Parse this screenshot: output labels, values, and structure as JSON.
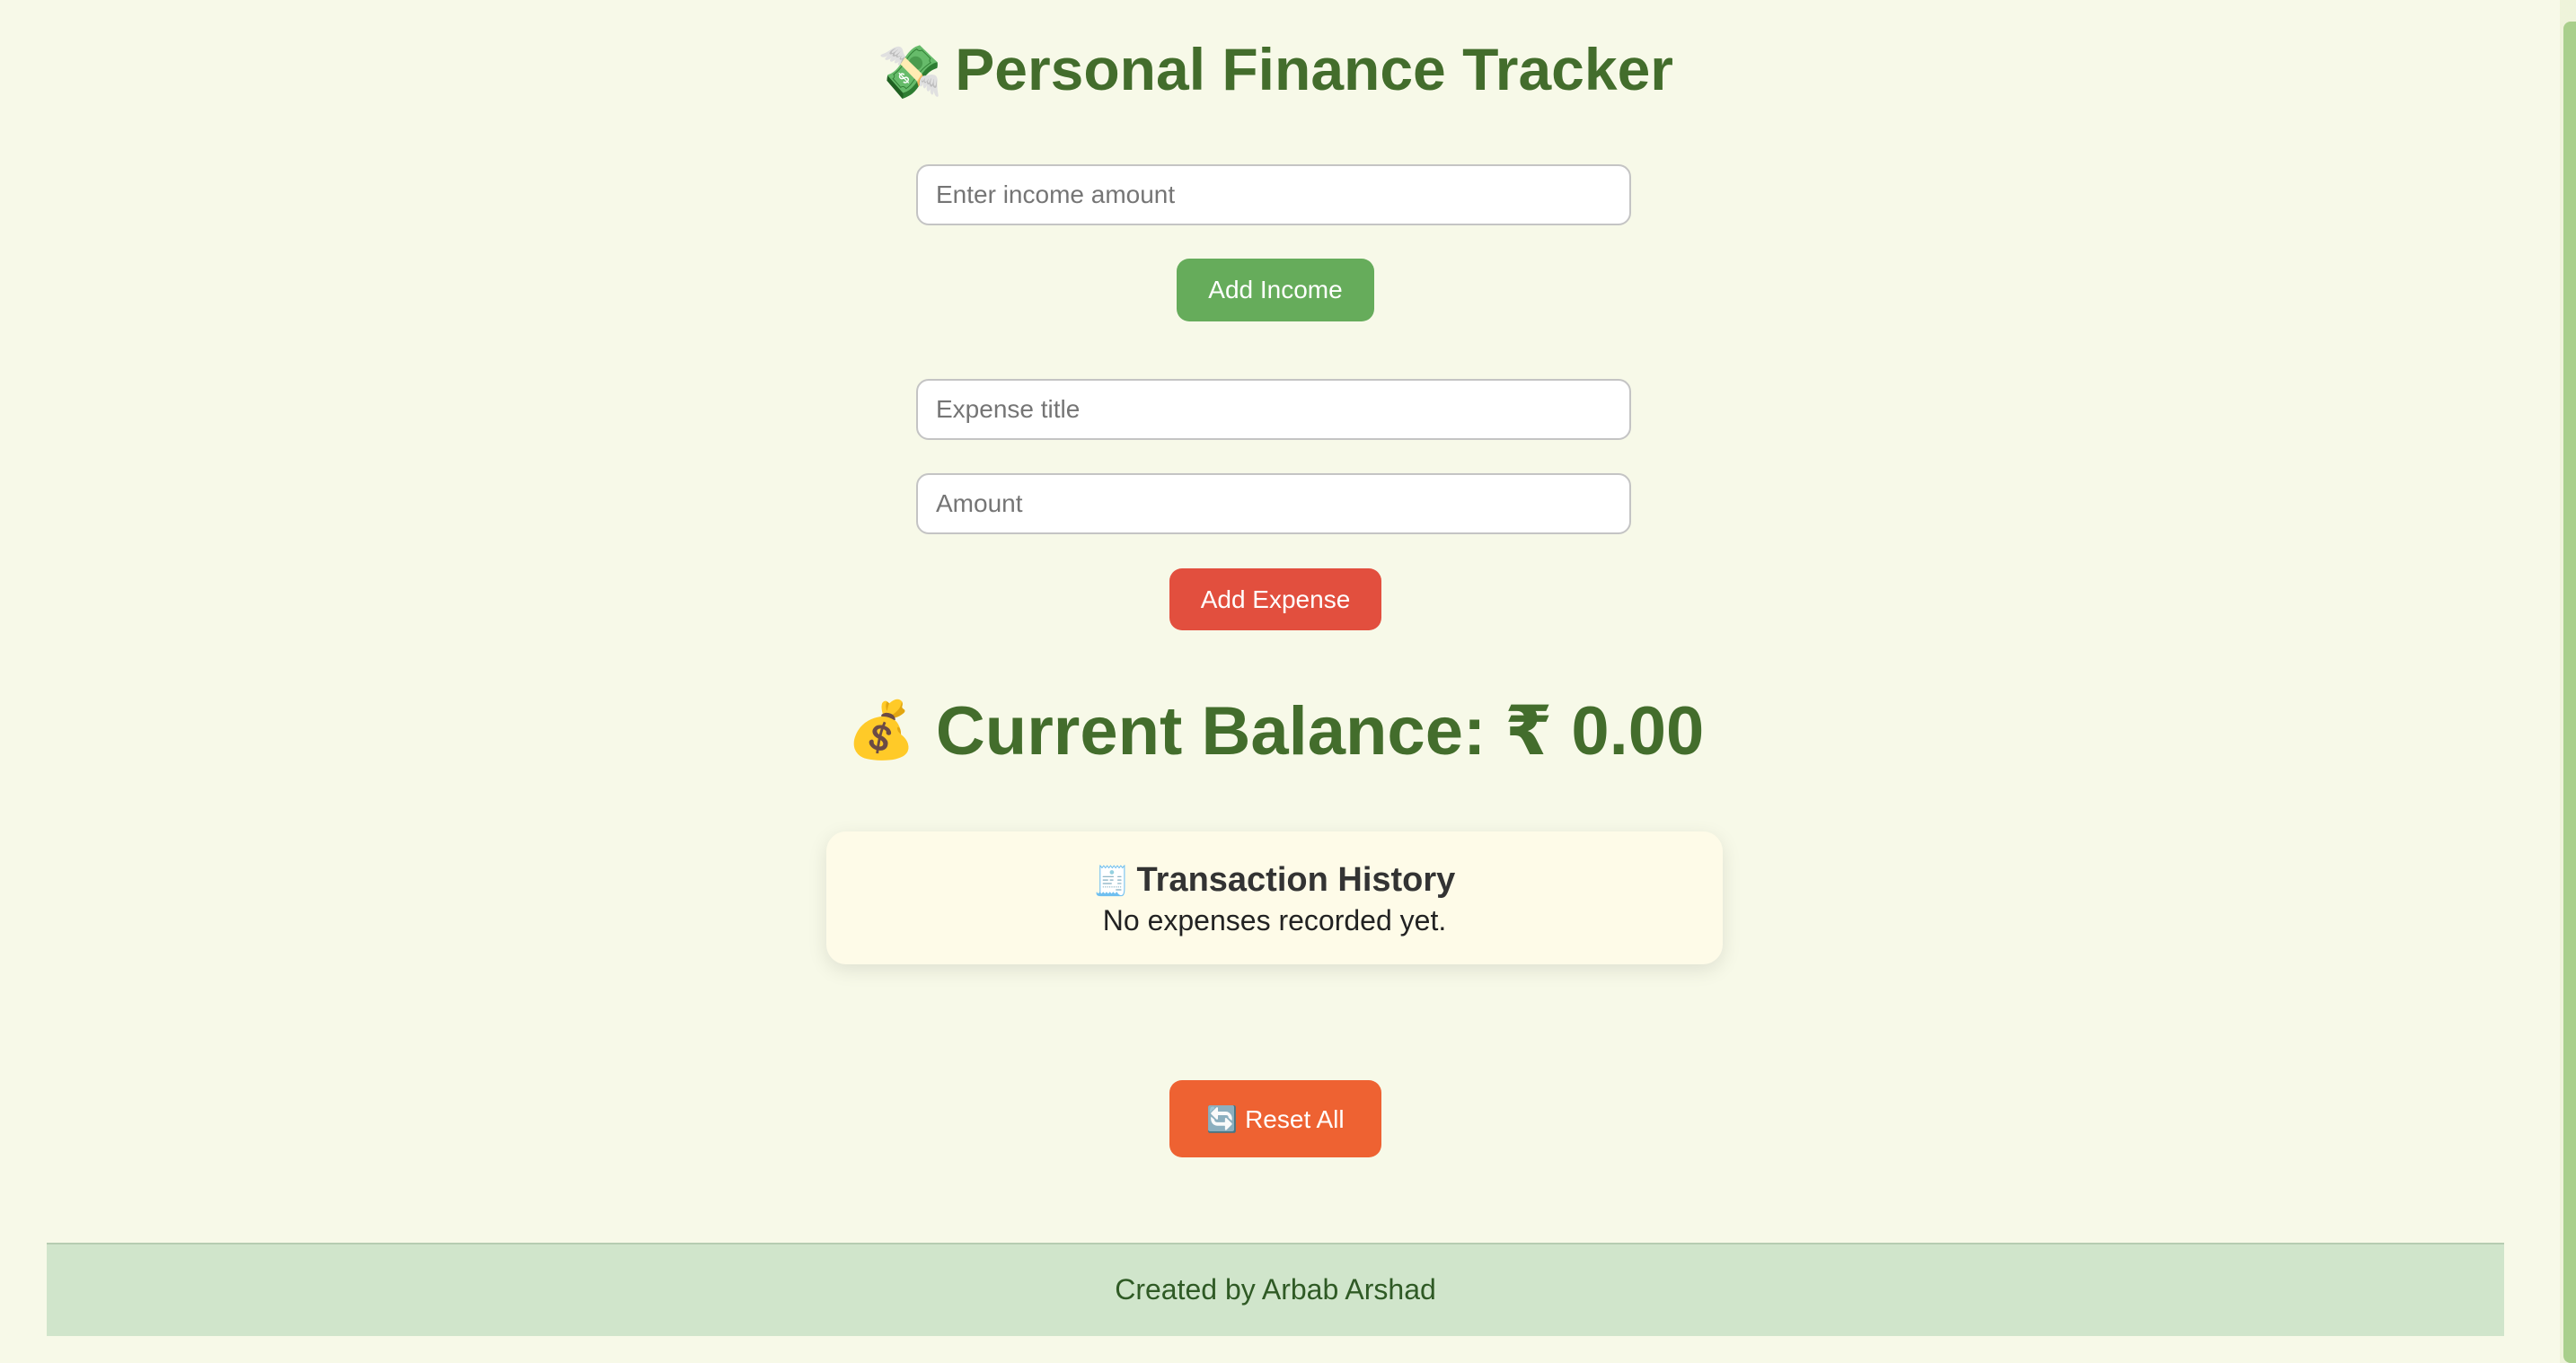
{
  "header": {
    "title_icon": "💸",
    "title": "Personal Finance Tracker"
  },
  "income": {
    "placeholder": "Enter income amount",
    "button_label": "Add Income"
  },
  "expense": {
    "title_placeholder": "Expense title",
    "amount_placeholder": "Amount",
    "button_label": "Add Expense"
  },
  "balance": {
    "icon": "💰",
    "text": "Current Balance: ₹ 0.00"
  },
  "history": {
    "icon": "🧾",
    "title": "Transaction History",
    "empty_message": "No expenses recorded yet."
  },
  "reset": {
    "icon": "🔄",
    "label": "Reset All"
  },
  "footer": {
    "text": "Created by Arbab Arshad"
  },
  "colors": {
    "background": "#f7f9e8",
    "accent_green": "#436d2c",
    "income_button": "#66ac5b",
    "expense_button": "#e24f3e",
    "reset_button": "#ee6232",
    "footer_bg": "#d0e5cb"
  }
}
